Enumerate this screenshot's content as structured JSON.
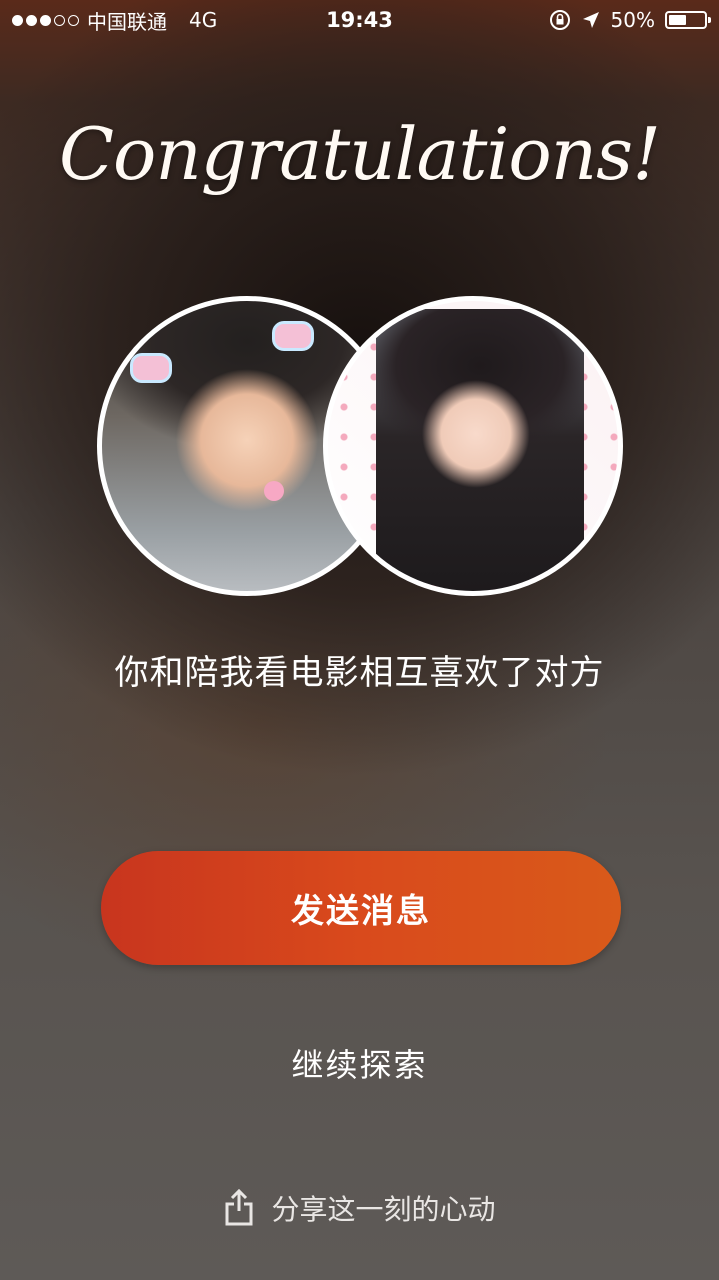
{
  "status_bar": {
    "signal_dots_filled": 3,
    "signal_dots_total": 5,
    "carrier": "中国联通",
    "network": "4G",
    "time": "19:43",
    "battery_percent": "50%",
    "battery_level": 0.5
  },
  "title": "Congratulations!",
  "avatars": {
    "left_icon": "user-photo",
    "right_icon": "user-photo"
  },
  "match_message": "你和陪我看电影相互喜欢了对方",
  "send_button_label": "发送消息",
  "continue_label": "继续探索",
  "share": {
    "icon": "share-icon",
    "label": "分享这一刻的心动"
  },
  "colors": {
    "button_start": "#c8351e",
    "button_end": "#d95a1a"
  }
}
